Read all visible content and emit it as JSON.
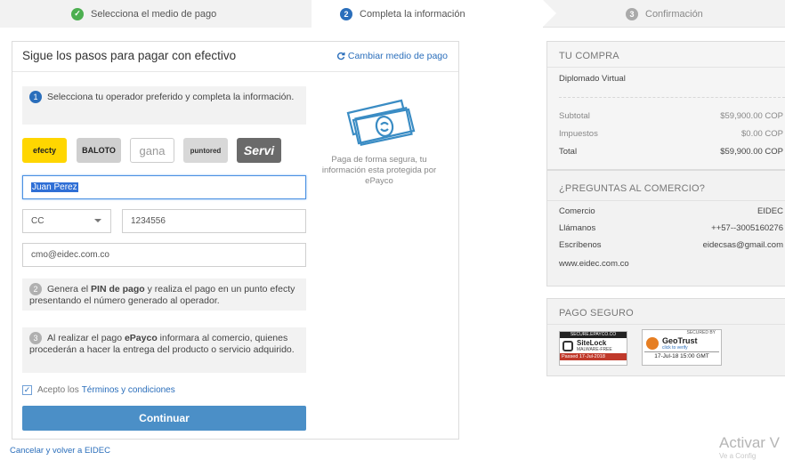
{
  "steps": [
    {
      "num": "✓",
      "label": "Selecciona el medio de pago"
    },
    {
      "num": "2",
      "label": "Completa la información"
    },
    {
      "num": "3",
      "label": "Confirmación"
    }
  ],
  "form": {
    "title": "Sigue los pasos para pagar con efectivo",
    "change_link": "Cambiar medio de pago",
    "step1": {
      "num": "1",
      "text": "Selecciona tu operador preferido y completa la información."
    },
    "operators": [
      "efecty",
      "BALOTO",
      "gana",
      "puntored",
      "Servi"
    ],
    "name_value": "Juan Perez",
    "doc_type": "CC",
    "doc_number": "1234556",
    "email_value": "cmo@eidec.com.co",
    "step2": {
      "num": "2",
      "text_a": "Genera el ",
      "text_b": "PIN de pago",
      "text_c": " y realiza el pago en un punto efecty presentando el número generado al operador."
    },
    "step3": {
      "num": "3",
      "text_a": "Al realizar el pago ",
      "text_b": "ePayco",
      "text_c": " informara al comercio, quienes procederán a hacer la entrega del producto o servicio adquirido."
    },
    "accept_text": "Acepto los",
    "terms_link": "Términos y condiciones",
    "submit": "Continuar",
    "secure_note": "Paga de forma segura, tu información esta protegida por ePayco"
  },
  "cancel_link": "Cancelar y volver a EIDEC",
  "purchase": {
    "heading": "TU COMPRA",
    "product": "Diplomado Virtual",
    "rows": [
      {
        "label": "Subtotal",
        "value": "$59,900.00 COP"
      },
      {
        "label": "Impuestos",
        "value": "$0.00 COP"
      },
      {
        "label": "Total",
        "value": "$59,900.00 COP"
      }
    ]
  },
  "questions": {
    "heading": "¿PREGUNTAS AL COMERCIO?",
    "rows": [
      {
        "label": "Comercio",
        "value": "EIDEC"
      },
      {
        "label": "Llámanos",
        "value": "++57--3005160276"
      },
      {
        "label": "Escríbenos",
        "value": "eidecsas@gmail.com"
      }
    ],
    "website": "www.eidec.com.co"
  },
  "secure": {
    "heading": "PAGO SEGURO",
    "sitelock": {
      "top": "SECURE.EPAYCO.CO",
      "brand": "SiteLock",
      "sub": "MALWARE-FREE",
      "passed": "Passed  17-Jul-2018"
    },
    "geotrust": {
      "top": "SECURED BY",
      "brand": "GeoTrust",
      "sub": "click to verify",
      "date": "17-Jul-18 15:00 GMT"
    }
  },
  "watermark": {
    "line1": "Activar V",
    "line2": "Ve a Config"
  },
  "colors": {
    "accent": "#2a6ebb",
    "button": "#4b8fc7",
    "success": "#4caf50"
  }
}
